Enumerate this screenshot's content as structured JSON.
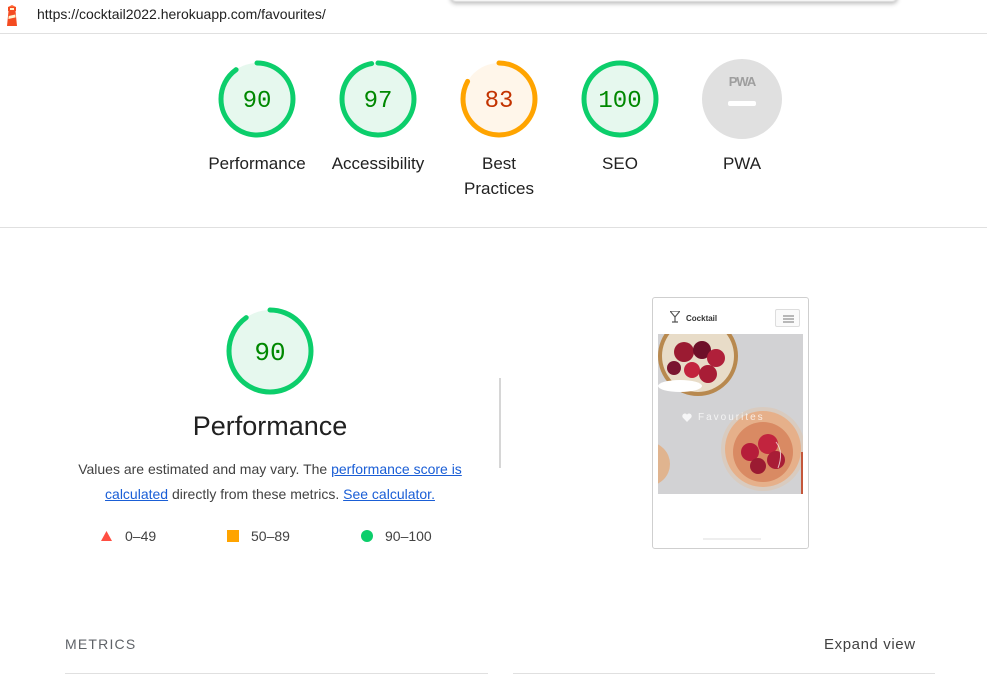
{
  "address_bar": {
    "url": "https://cocktail2022.herokuapp.com/favourites/",
    "logo_icon": "lighthouse-icon"
  },
  "colors": {
    "pass": "#0cce6b",
    "pass_text": "#008800",
    "pass_bg": "#e6f8ee",
    "average": "#ffa400",
    "average_text": "#c33300",
    "average_bg": "#fff6ea",
    "fail": "#ff4e42",
    "na": "#e0e0e0",
    "link": "#1a5ed6"
  },
  "category_gauges": [
    {
      "label": "Performance",
      "score": "90",
      "fraction": 0.9,
      "rating": "pass"
    },
    {
      "label": "Accessibility",
      "score": "97",
      "fraction": 0.97,
      "rating": "pass"
    },
    {
      "label": "Best\nPractices",
      "score": "83",
      "fraction": 0.83,
      "rating": "average"
    },
    {
      "label": "SEO",
      "score": "100",
      "fraction": 1.0,
      "rating": "pass"
    },
    {
      "label": "PWA",
      "badge_text": "PWA",
      "rating": "na"
    }
  ],
  "performance": {
    "score": "90",
    "fraction": 0.9,
    "title": "Performance",
    "desc_prefix": "Values are estimated and may vary. The ",
    "link_score": "performance score is calculated",
    "desc_middle": " directly from these metrics. ",
    "link_calc": "See calculator."
  },
  "legend": [
    {
      "shape": "triangle",
      "range": "0–49",
      "color": "#ff4e42"
    },
    {
      "shape": "square",
      "range": "50–89",
      "color": "#ffa400"
    },
    {
      "shape": "circle",
      "range": "90–100",
      "color": "#0cce6b"
    }
  ],
  "screenshot": {
    "brand": "Cocktail",
    "overlay_text": "Favourites",
    "brand_icon": "cocktail-glass-icon",
    "menu_icon": "hamburger-icon",
    "heart_icon": "heart-icon"
  },
  "metrics": {
    "title": "METRICS",
    "expand": "Expand view"
  }
}
